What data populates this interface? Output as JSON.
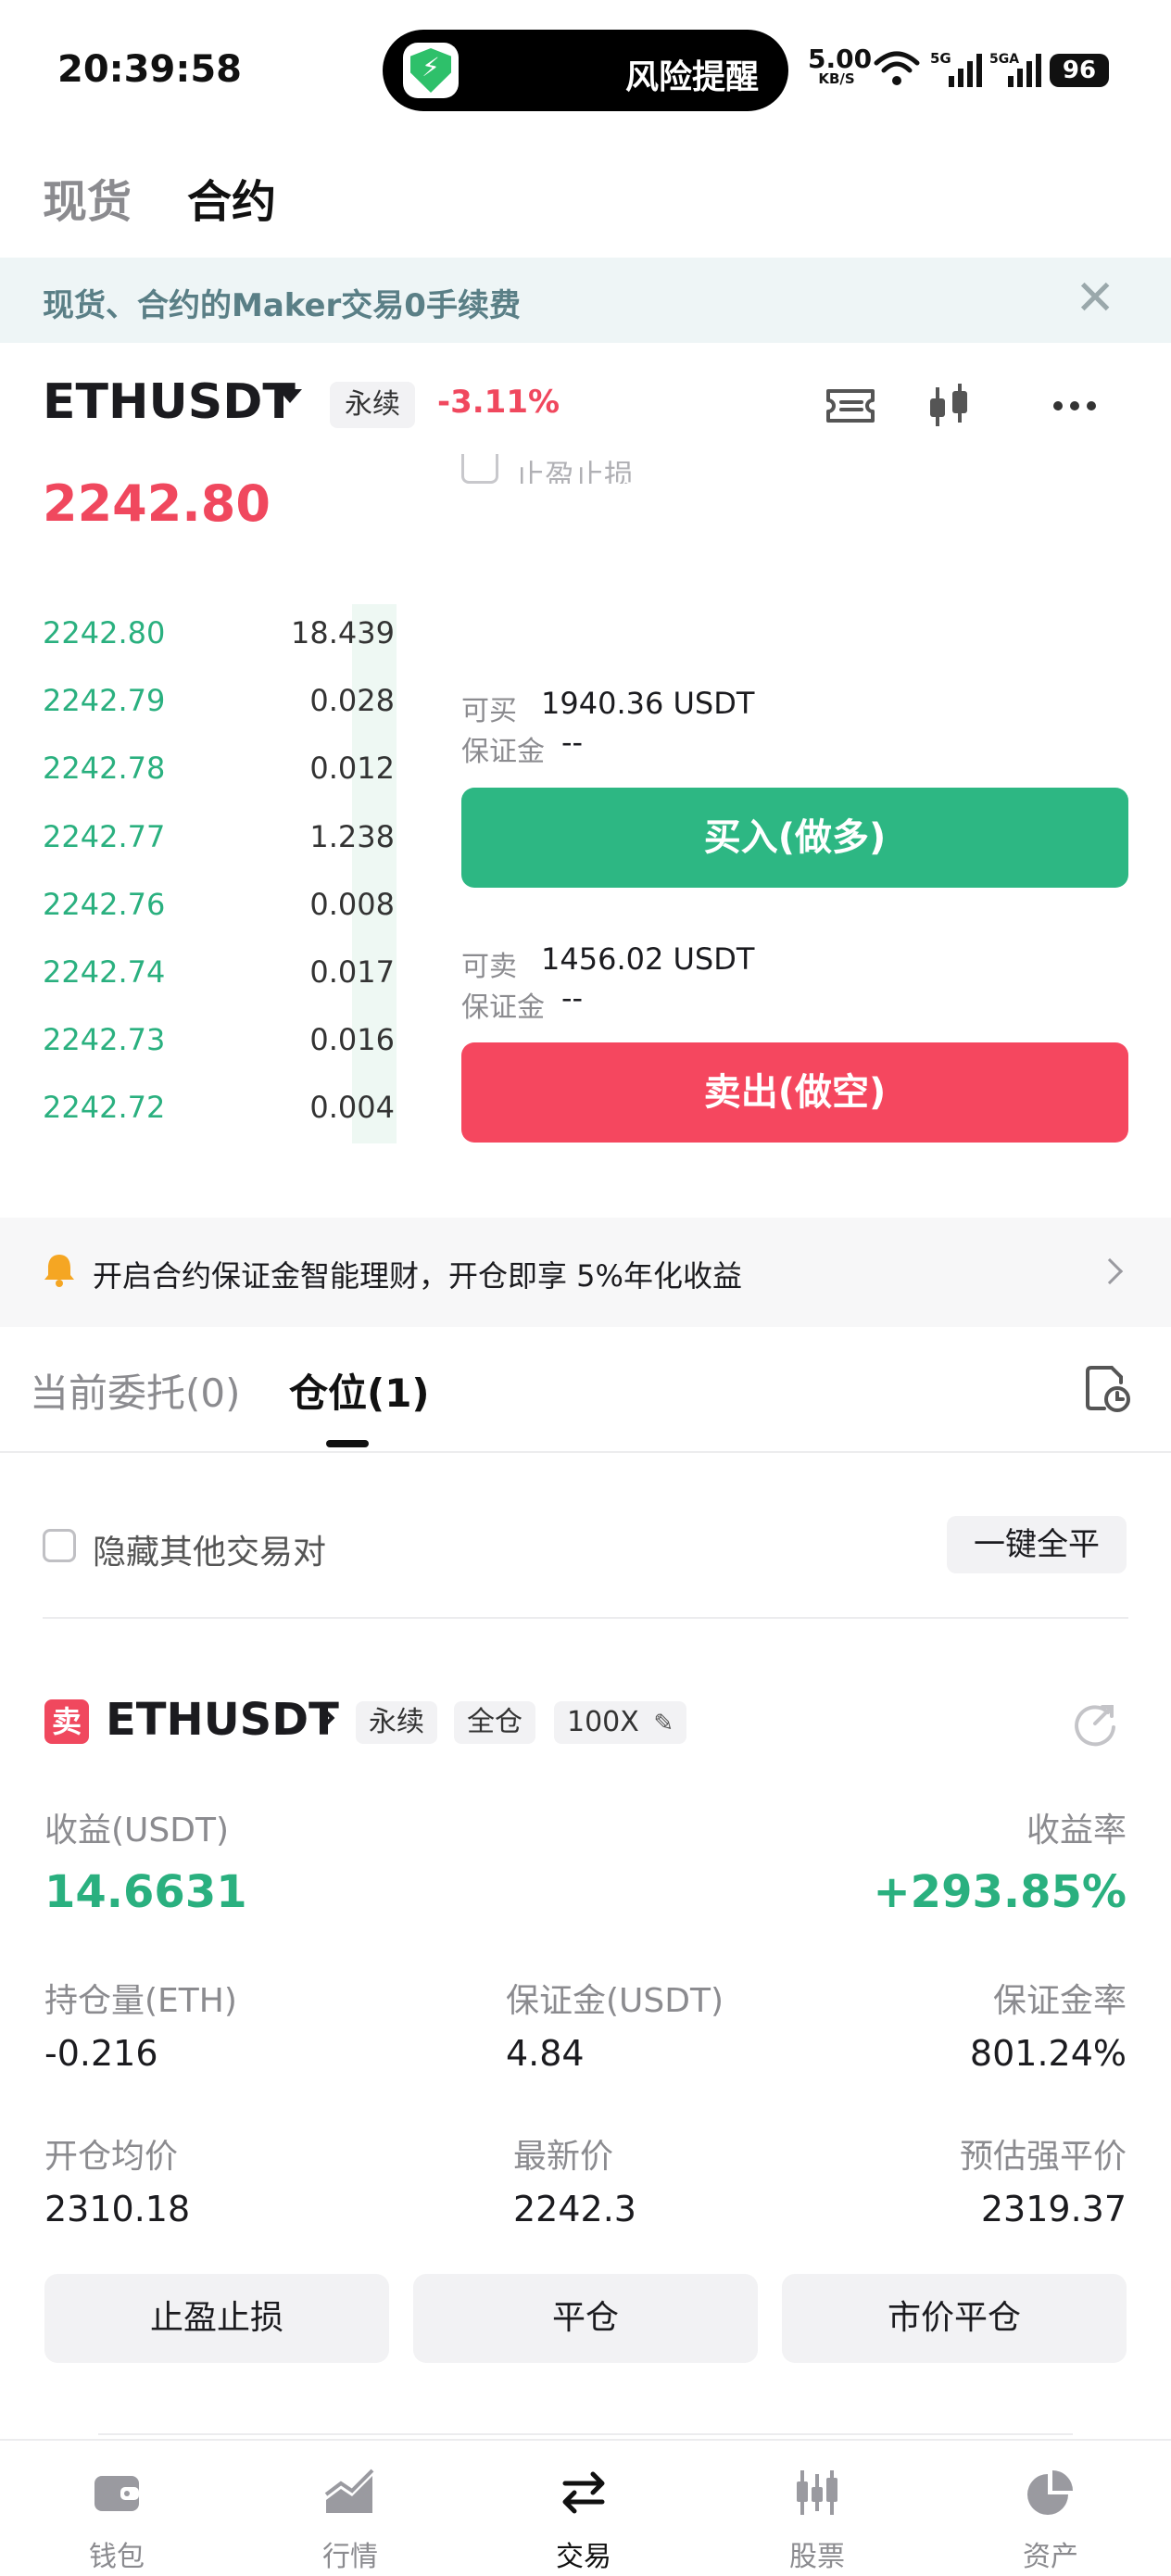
{
  "status_bar": {
    "time": "20:39:58",
    "island_text": "风险提醒",
    "net_speed_value": "5.00",
    "net_speed_unit": "KB/S",
    "signal1": "5G",
    "signal2": "5GA",
    "battery": "96"
  },
  "market_tabs": {
    "spot": "现货",
    "contract": "合约"
  },
  "banner": {
    "text": "现货、合约的Maker交易0手续费",
    "close": "✕"
  },
  "pair": {
    "name": "ETHUSDT",
    "type": "永续",
    "change": "-3.11%",
    "last_price": "2242.80",
    "partial_label": "止盈止损"
  },
  "order_book": [
    {
      "price": "2242.80",
      "qty": "18.439"
    },
    {
      "price": "2242.79",
      "qty": "0.028"
    },
    {
      "price": "2242.78",
      "qty": "0.012"
    },
    {
      "price": "2242.77",
      "qty": "1.238"
    },
    {
      "price": "2242.76",
      "qty": "0.008"
    },
    {
      "price": "2242.74",
      "qty": "0.017"
    },
    {
      "price": "2242.73",
      "qty": "0.016"
    },
    {
      "price": "2242.72",
      "qty": "0.004"
    }
  ],
  "order_panel": {
    "buy_avail_label": "可买",
    "buy_avail_value": "1940.36 USDT",
    "buy_margin_label": "保证金",
    "buy_margin_value": "--",
    "buy_button": "买入(做多)",
    "sell_avail_label": "可卖",
    "sell_avail_value": "1456.02 USDT",
    "sell_margin_label": "保证金",
    "sell_margin_value": "--",
    "sell_button": "卖出(做空)"
  },
  "promo": {
    "text": "开启合约保证金智能理财，开仓即享 5%年化收益"
  },
  "order_tabs": {
    "current": "当前委托(0)",
    "position": "仓位(1)"
  },
  "filter": {
    "hide_label": "隐藏其他交易对",
    "close_all": "一键全平"
  },
  "position": {
    "side": "卖",
    "pair": "ETHUSDT",
    "type": "永续",
    "margin_mode": "全仓",
    "leverage": "100X",
    "pnl_label": "收益(USDT)",
    "pnl_value": "14.6631",
    "roe_label": "收益率",
    "roe_value": "+293.85%",
    "size_label": "持仓量(ETH)",
    "size_value": "-0.216",
    "margin_label": "保证金(USDT)",
    "margin_value": "4.84",
    "margin_ratio_label": "保证金率",
    "margin_ratio_value": "801.24%",
    "entry_label": "开仓均价",
    "entry_value": "2310.18",
    "mark_label": "最新价",
    "mark_value": "2242.3",
    "liq_label": "预估强平价",
    "liq_value": "2319.37",
    "btn_tpsl": "止盈止损",
    "btn_close": "平仓",
    "btn_market_close": "市价平仓"
  },
  "bottom_nav": [
    {
      "label": "钱包",
      "icon": "wallet-icon"
    },
    {
      "label": "行情",
      "icon": "chart-icon"
    },
    {
      "label": "交易",
      "icon": "swap-icon"
    },
    {
      "label": "股票",
      "icon": "stocks-icon"
    },
    {
      "label": "资产",
      "icon": "pie-icon"
    }
  ],
  "colors": {
    "up": "#2ab07f",
    "down": "#f0485e",
    "buy": "#2db783",
    "sell": "#f5475f"
  }
}
